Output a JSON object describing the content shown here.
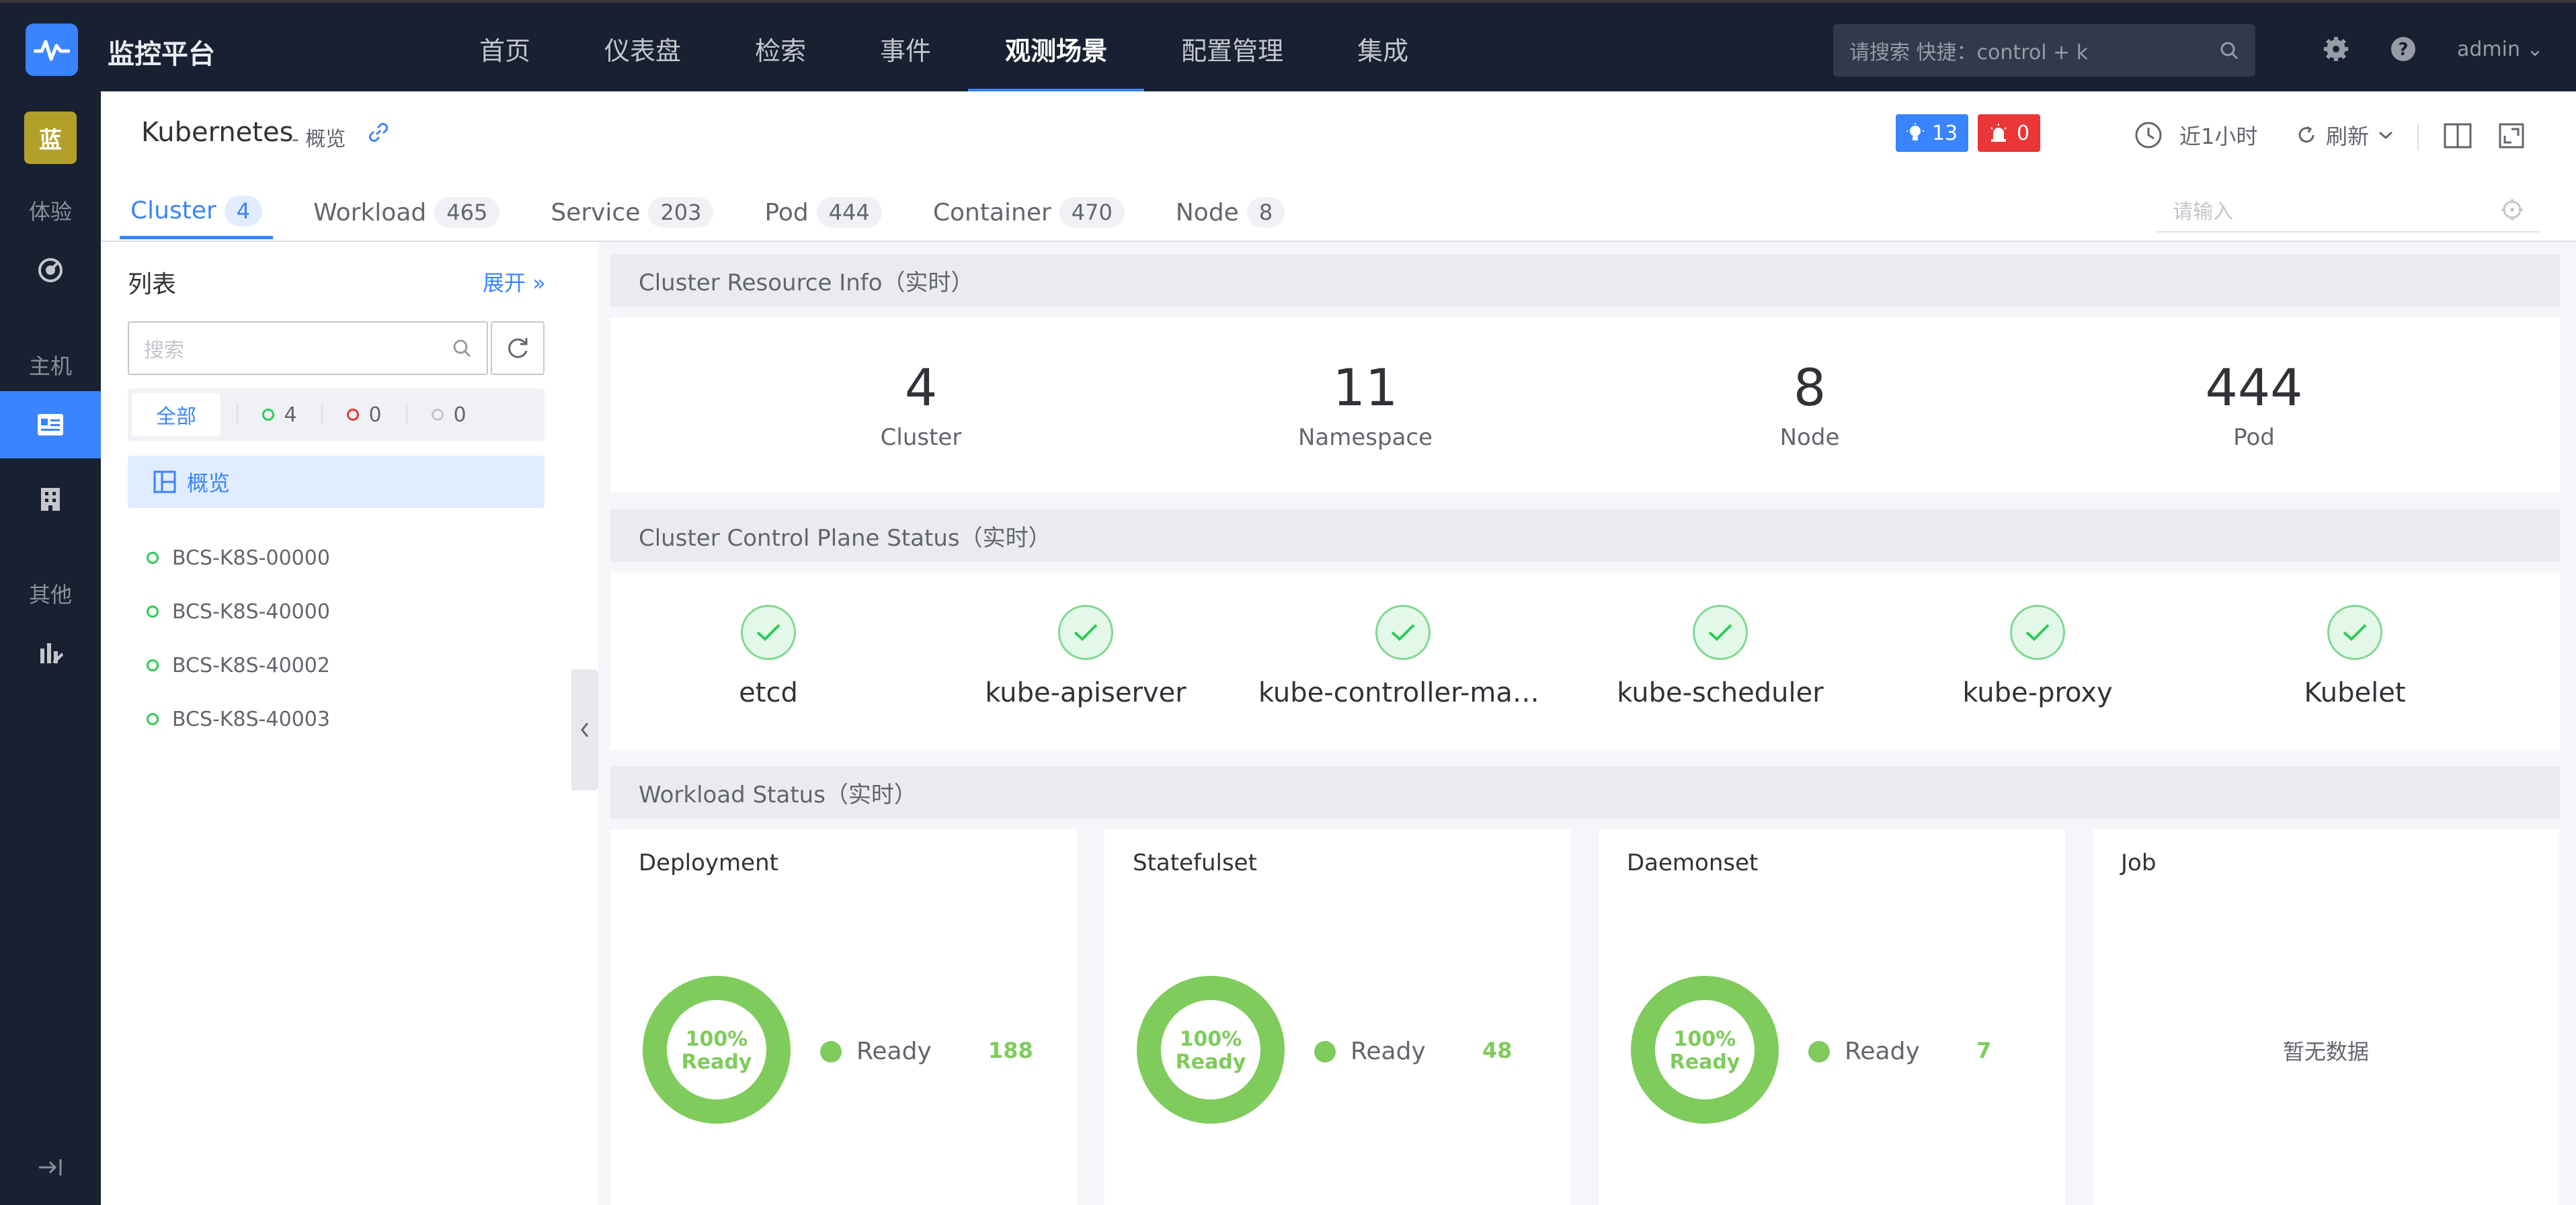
{
  "app": {
    "title": "监控平台"
  },
  "nav": {
    "items": [
      "首页",
      "仪表盘",
      "检索",
      "事件",
      "观测场景",
      "配置管理",
      "集成"
    ],
    "active": "观测场景"
  },
  "global_search": {
    "placeholder": "请搜索 快捷：control + k"
  },
  "user": {
    "name": "admin"
  },
  "leftnav": {
    "avatar": "蓝",
    "groups": [
      "体验",
      "主机",
      "其他"
    ]
  },
  "page": {
    "title": "Kubernetes",
    "subtitle": "- 概览"
  },
  "alerts": {
    "info_count": "13",
    "error_count": "0"
  },
  "toolbar": {
    "time_range": "近1小时",
    "refresh": "刷新"
  },
  "tabs": [
    {
      "label": "Cluster",
      "count": "4"
    },
    {
      "label": "Workload",
      "count": "465"
    },
    {
      "label": "Service",
      "count": "203"
    },
    {
      "label": "Pod",
      "count": "444"
    },
    {
      "label": "Container",
      "count": "470"
    },
    {
      "label": "Node",
      "count": "8"
    }
  ],
  "tab_search": {
    "placeholder": "请输入"
  },
  "list": {
    "title": "列表",
    "expand": "展开",
    "search_placeholder": "搜索",
    "filters": {
      "all": "全部",
      "normal": "4",
      "error": "0",
      "unknown": "0"
    },
    "overview": "概览",
    "clusters": [
      "BCS-K8S-00000",
      "BCS-K8S-40000",
      "BCS-K8S-40002",
      "BCS-K8S-40003"
    ]
  },
  "resource": {
    "title": "Cluster Resource Info（实时）",
    "stats": [
      {
        "value": "4",
        "label": "Cluster"
      },
      {
        "value": "11",
        "label": "Namespace"
      },
      {
        "value": "8",
        "label": "Node"
      },
      {
        "value": "444",
        "label": "Pod"
      }
    ]
  },
  "control_plane": {
    "title": "Cluster Control Plane Status（实时）",
    "components": [
      "etcd",
      "kube-apiserver",
      "kube-controller-man…",
      "kube-scheduler",
      "kube-proxy",
      "Kubelet"
    ]
  },
  "workload": {
    "title": "Workload Status（实时）",
    "cards": [
      {
        "name": "Deployment",
        "percent_line1": "100%",
        "percent_line2": "Ready",
        "legend": "Ready",
        "value": "188"
      },
      {
        "name": "Statefulset",
        "percent_line1": "100%",
        "percent_line2": "Ready",
        "legend": "Ready",
        "value": "48"
      },
      {
        "name": "Daemonset",
        "percent_line1": "100%",
        "percent_line2": "Ready",
        "legend": "Ready",
        "value": "7"
      },
      {
        "name": "Job",
        "empty": "暂无数据"
      }
    ]
  },
  "colors": {
    "primary": "#3a84ff",
    "success": "#7fcb5c",
    "danger": "#ea3636",
    "nav_bg": "#182132"
  }
}
